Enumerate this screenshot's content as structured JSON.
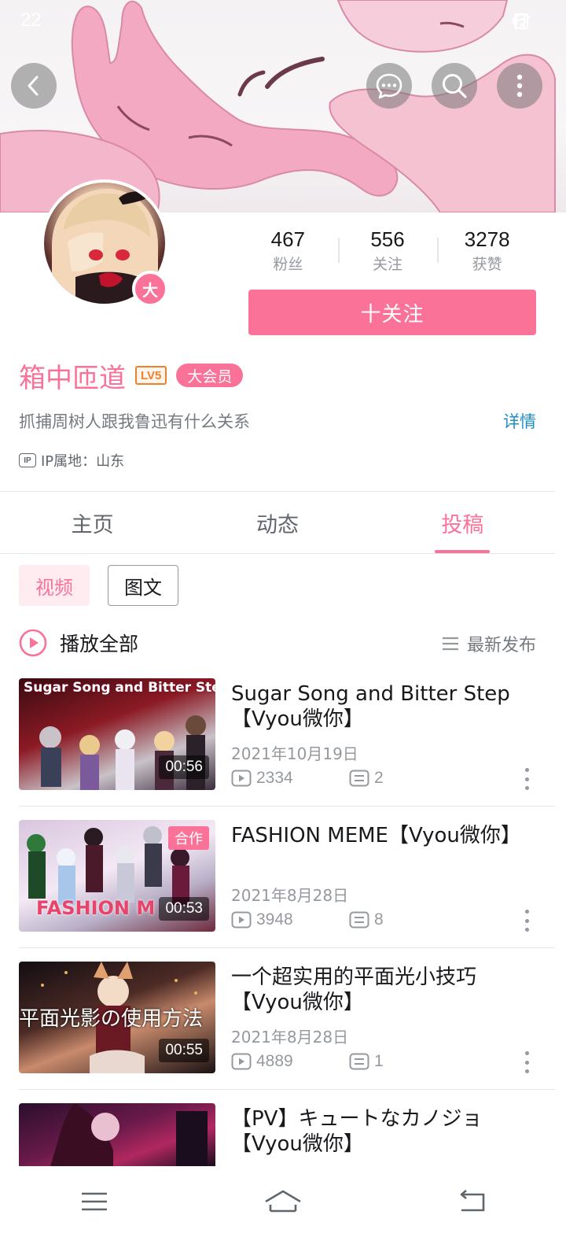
{
  "status_bar": {
    "time": "22"
  },
  "header": {
    "back_icon": "chevron-left-icon",
    "message_icon": "chat-bubble-icon",
    "search_icon": "search-icon",
    "more_icon": "more-vertical-icon"
  },
  "profile": {
    "avatar_badge": "大",
    "stats": [
      {
        "value": "467",
        "label": "粉丝"
      },
      {
        "value": "556",
        "label": "关注"
      },
      {
        "value": "3278",
        "label": "获赞"
      }
    ],
    "follow_button": "十关注",
    "name": "箱中匝道",
    "level": "LV5",
    "vip": "大会员",
    "signature": "抓捕周树人跟我鲁迅有什么关系",
    "detail_link": "详情",
    "ip_tag": "IP",
    "ip_location": "IP属地：山东"
  },
  "tabs": [
    {
      "label": "主页",
      "active": false
    },
    {
      "label": "动态",
      "active": false
    },
    {
      "label": "投稿",
      "active": true
    }
  ],
  "filters": {
    "video": "视频",
    "article": "图文"
  },
  "playlist": {
    "play_all": "播放全部",
    "sort": "最新发布"
  },
  "videos": [
    {
      "title": "Sugar Song and Bitter Step【Vyou微你】",
      "date": "2021年10月19日",
      "views": "2334",
      "comments": "2",
      "duration": "00:56",
      "thumb_text": "Sugar Song and Bitter Step",
      "coop": ""
    },
    {
      "title": "FASHION MEME【Vyou微你】",
      "date": "2021年8月28日",
      "views": "3948",
      "comments": "8",
      "duration": "00:53",
      "thumb_text": "FASHION M",
      "coop": "合作"
    },
    {
      "title": "一个超实用的平面光小技巧【Vyou微你】",
      "date": "2021年8月28日",
      "views": "4889",
      "comments": "1",
      "duration": "00:55",
      "thumb_text": "平面光影の使用方法",
      "coop": ""
    },
    {
      "title": "【PV】キュートなカノジョ【Vyou微你】",
      "date": "",
      "views": "",
      "comments": "",
      "duration": "",
      "thumb_text": "",
      "coop": ""
    }
  ],
  "colors": {
    "accent": "#fb7299",
    "link": "#1c8fc4",
    "level": "#f0812c"
  }
}
